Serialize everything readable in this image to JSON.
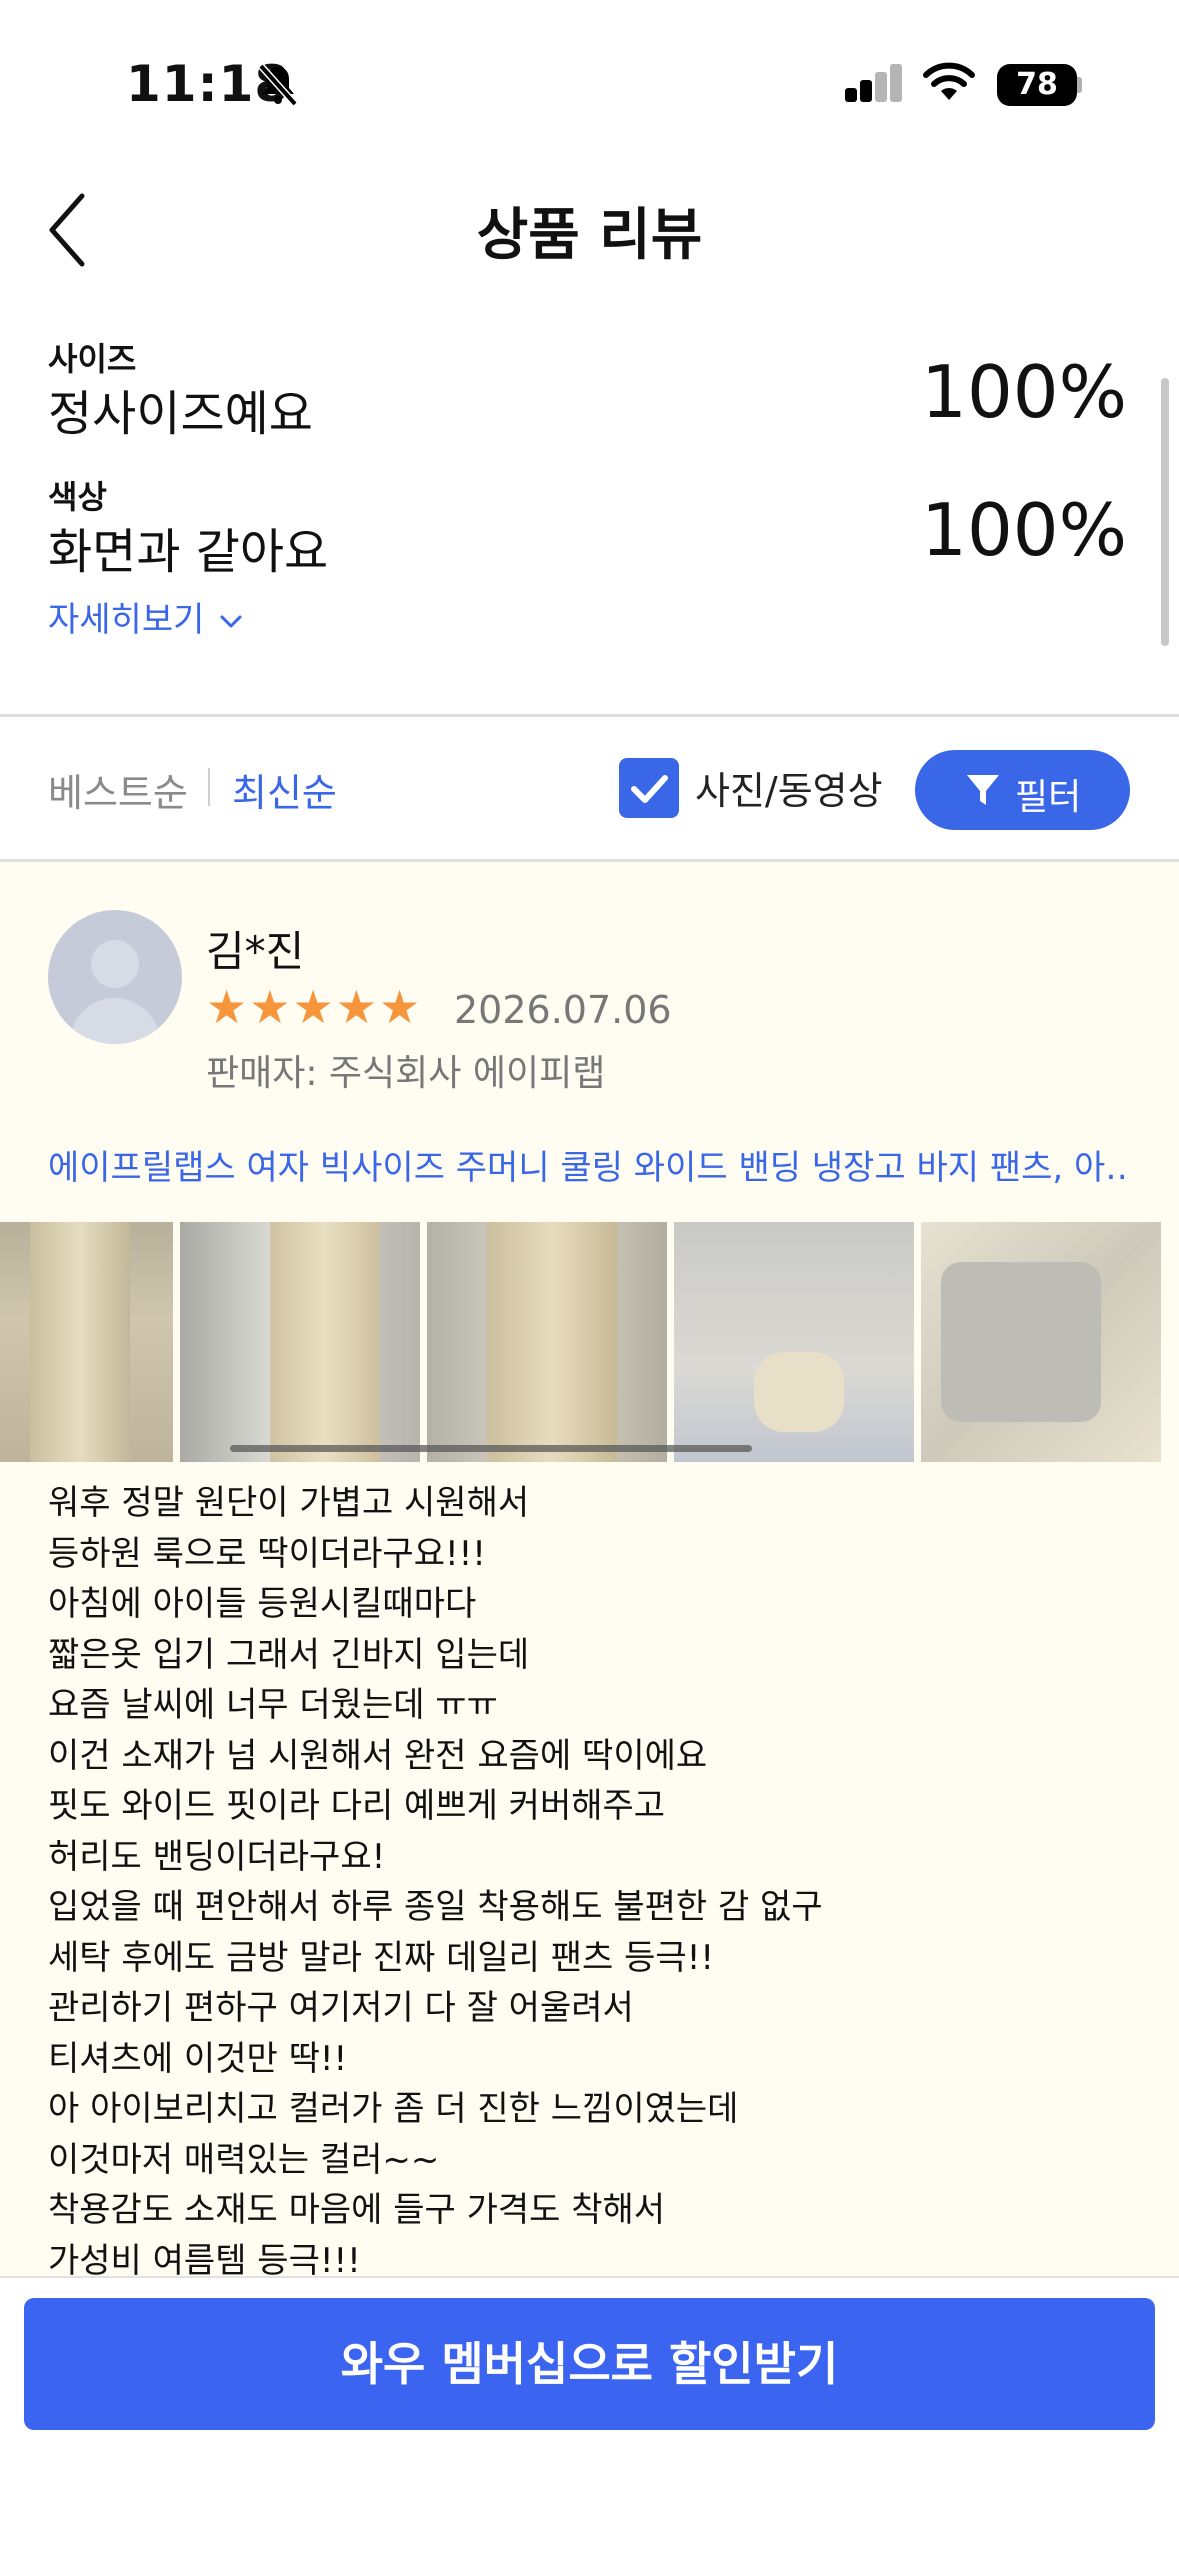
{
  "status_bar": {
    "time": "11:18",
    "battery": "78"
  },
  "header": {
    "title": "상품 리뷰"
  },
  "summary": {
    "size_label": "사이즈",
    "size_value": "정사이즈예요",
    "size_percent": "100%",
    "color_label": "색상",
    "color_value": "화면과 같아요",
    "color_percent": "100%",
    "detail_link": "자세히보기"
  },
  "sort": {
    "best": "베스트순",
    "newest": "최신순",
    "photo_video": "사진/동영상",
    "photo_video_checked": true,
    "filter": "필터"
  },
  "review": {
    "name": "김*진",
    "rating": 5,
    "date": "2026.07.06",
    "seller": "판매자: 주식회사 에이피랩",
    "product": "에이프릴랩스 여자 빅사이즈 주머니 쿨링 와이드 밴딩 냉장고 바지 팬츠, 아…",
    "lines": [
      "워후 정말 원단이 가볍고 시원해서",
      "등하원 룩으로 딱이더라구요!!!",
      "아침에 아이들 등원시킬때마다",
      "짧은옷 입기 그래서 긴바지 입는데",
      "요즘 날씨에 너무 더웠는데 ㅠㅠ",
      "이건 소재가 넘 시원해서 완전 요즘에 딱이에요",
      "핏도 와이드 핏이라 다리 예쁘게 커버해주고",
      "허리도 밴딩이더라구요!",
      "입었을 때 편안해서 하루 종일 착용해도 불편한 감 없구",
      "세탁 후에도 금방 말라 진짜 데일리 팬츠 등극!!",
      "관리하기 편하구 여기저기 다 잘 어울려서",
      "티셔츠에 이것만 딱!!",
      "아 아이보리치고 컬러가 좀 더 진한 느낌이였는데",
      "이것마저 매력있는 컬러~~",
      "착용감도 소재도 마음에 들구 가격도 착해서",
      "가성비 여름템 등극!!!"
    ]
  },
  "cta": {
    "label": "와우 멤버십으로 할인받기"
  },
  "colors": {
    "accent": "#3a66e8",
    "star": "#f6953c",
    "review_bg": "#fffdf1"
  }
}
